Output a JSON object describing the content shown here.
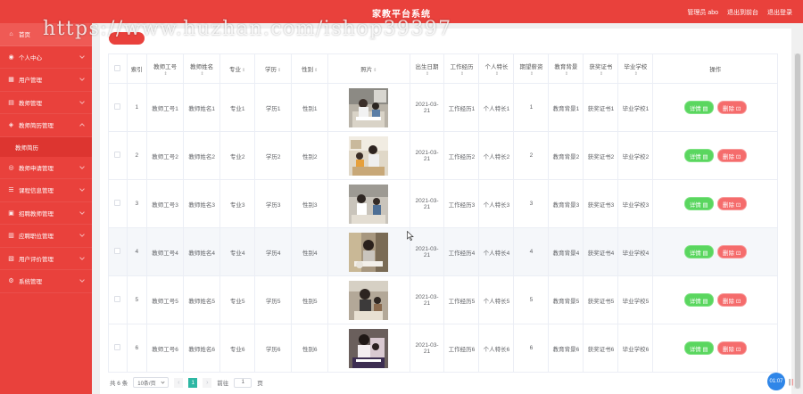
{
  "app": {
    "title": "家教平台系统"
  },
  "header": {
    "links": [
      "管理员 abo",
      "退出到前台",
      "退出登录"
    ]
  },
  "watermark": "https://www.huzhan.com/ishop39397",
  "sidebar": {
    "items": [
      {
        "label": "首页",
        "icon": "home-icon",
        "active": true
      },
      {
        "label": "个人中心",
        "icon": "user-icon"
      },
      {
        "label": "用户管理",
        "icon": "users-icon"
      },
      {
        "label": "教师管理",
        "icon": "teacher-icon"
      },
      {
        "label": "教师简历管理",
        "icon": "resume-icon",
        "open": true
      },
      {
        "label": "教师申请管理",
        "icon": "apply-icon"
      },
      {
        "label": "课程信息管理",
        "icon": "course-icon"
      },
      {
        "label": "招聘教师管理",
        "icon": "recruit-icon"
      },
      {
        "label": "应聘职位管理",
        "icon": "position-icon"
      },
      {
        "label": "用户评价管理",
        "icon": "review-icon"
      },
      {
        "label": "系统管理",
        "icon": "system-icon"
      }
    ],
    "sub_item": "教师简历"
  },
  "table": {
    "headers": [
      "索引",
      "教师工号",
      "教师姓名",
      "专业",
      "学历",
      "性别",
      "照片",
      "出生日期",
      "工作经历",
      "个人特长",
      "期望薪资",
      "教育背景",
      "获奖证书",
      "毕业学校",
      "操作"
    ],
    "rows": [
      {
        "index": "1",
        "no": "教师工号1",
        "name": "教师姓名1",
        "major": "专业1",
        "edu": "学历1",
        "gender": "性别1",
        "birth": "2021-03-21",
        "work": "工作经历1",
        "skill": "个人特长1",
        "salary": "1",
        "bg": "教育背景1",
        "cert": "获奖证书1",
        "school": "毕业学校1"
      },
      {
        "index": "2",
        "no": "教师工号2",
        "name": "教师姓名2",
        "major": "专业2",
        "edu": "学历2",
        "gender": "性别2",
        "birth": "2021-03-21",
        "work": "工作经历2",
        "skill": "个人特长2",
        "salary": "2",
        "bg": "教育背景2",
        "cert": "获奖证书2",
        "school": "毕业学校2"
      },
      {
        "index": "3",
        "no": "教师工号3",
        "name": "教师姓名3",
        "major": "专业3",
        "edu": "学历3",
        "gender": "性别3",
        "birth": "2021-03-21",
        "work": "工作经历3",
        "skill": "个人特长3",
        "salary": "3",
        "bg": "教育背景3",
        "cert": "获奖证书3",
        "school": "毕业学校3"
      },
      {
        "index": "4",
        "no": "教师工号4",
        "name": "教师姓名4",
        "major": "专业4",
        "edu": "学历4",
        "gender": "性别4",
        "birth": "2021-03-21",
        "work": "工作经历4",
        "skill": "个人特长4",
        "salary": "4",
        "bg": "教育背景4",
        "cert": "获奖证书4",
        "school": "毕业学校4"
      },
      {
        "index": "5",
        "no": "教师工号5",
        "name": "教师姓名5",
        "major": "专业5",
        "edu": "学历5",
        "gender": "性别5",
        "birth": "2021-03-21",
        "work": "工作经历5",
        "skill": "个人特长5",
        "salary": "5",
        "bg": "教育背景5",
        "cert": "获奖证书5",
        "school": "毕业学校5"
      },
      {
        "index": "6",
        "no": "教师工号6",
        "name": "教师姓名6",
        "major": "专业6",
        "edu": "学历6",
        "gender": "性别6",
        "birth": "2021-03-21",
        "work": "工作经历6",
        "skill": "个人特长6",
        "salary": "6",
        "bg": "教育背景6",
        "cert": "获奖证书6",
        "school": "毕业学校6"
      }
    ],
    "actions": {
      "detail": "详情 ▤",
      "delete": "删除 ⊡"
    }
  },
  "pager": {
    "total": "共 6 条",
    "page_size": "10条/页",
    "current": "1",
    "goto_label": "前往",
    "goto_value": "1",
    "page_unit": "页"
  },
  "clock": "01:07",
  "colors": {
    "brand": "#e9413c",
    "detail": "#5ad65f",
    "delete": "#f56c6c",
    "page": "#2db7a3"
  }
}
